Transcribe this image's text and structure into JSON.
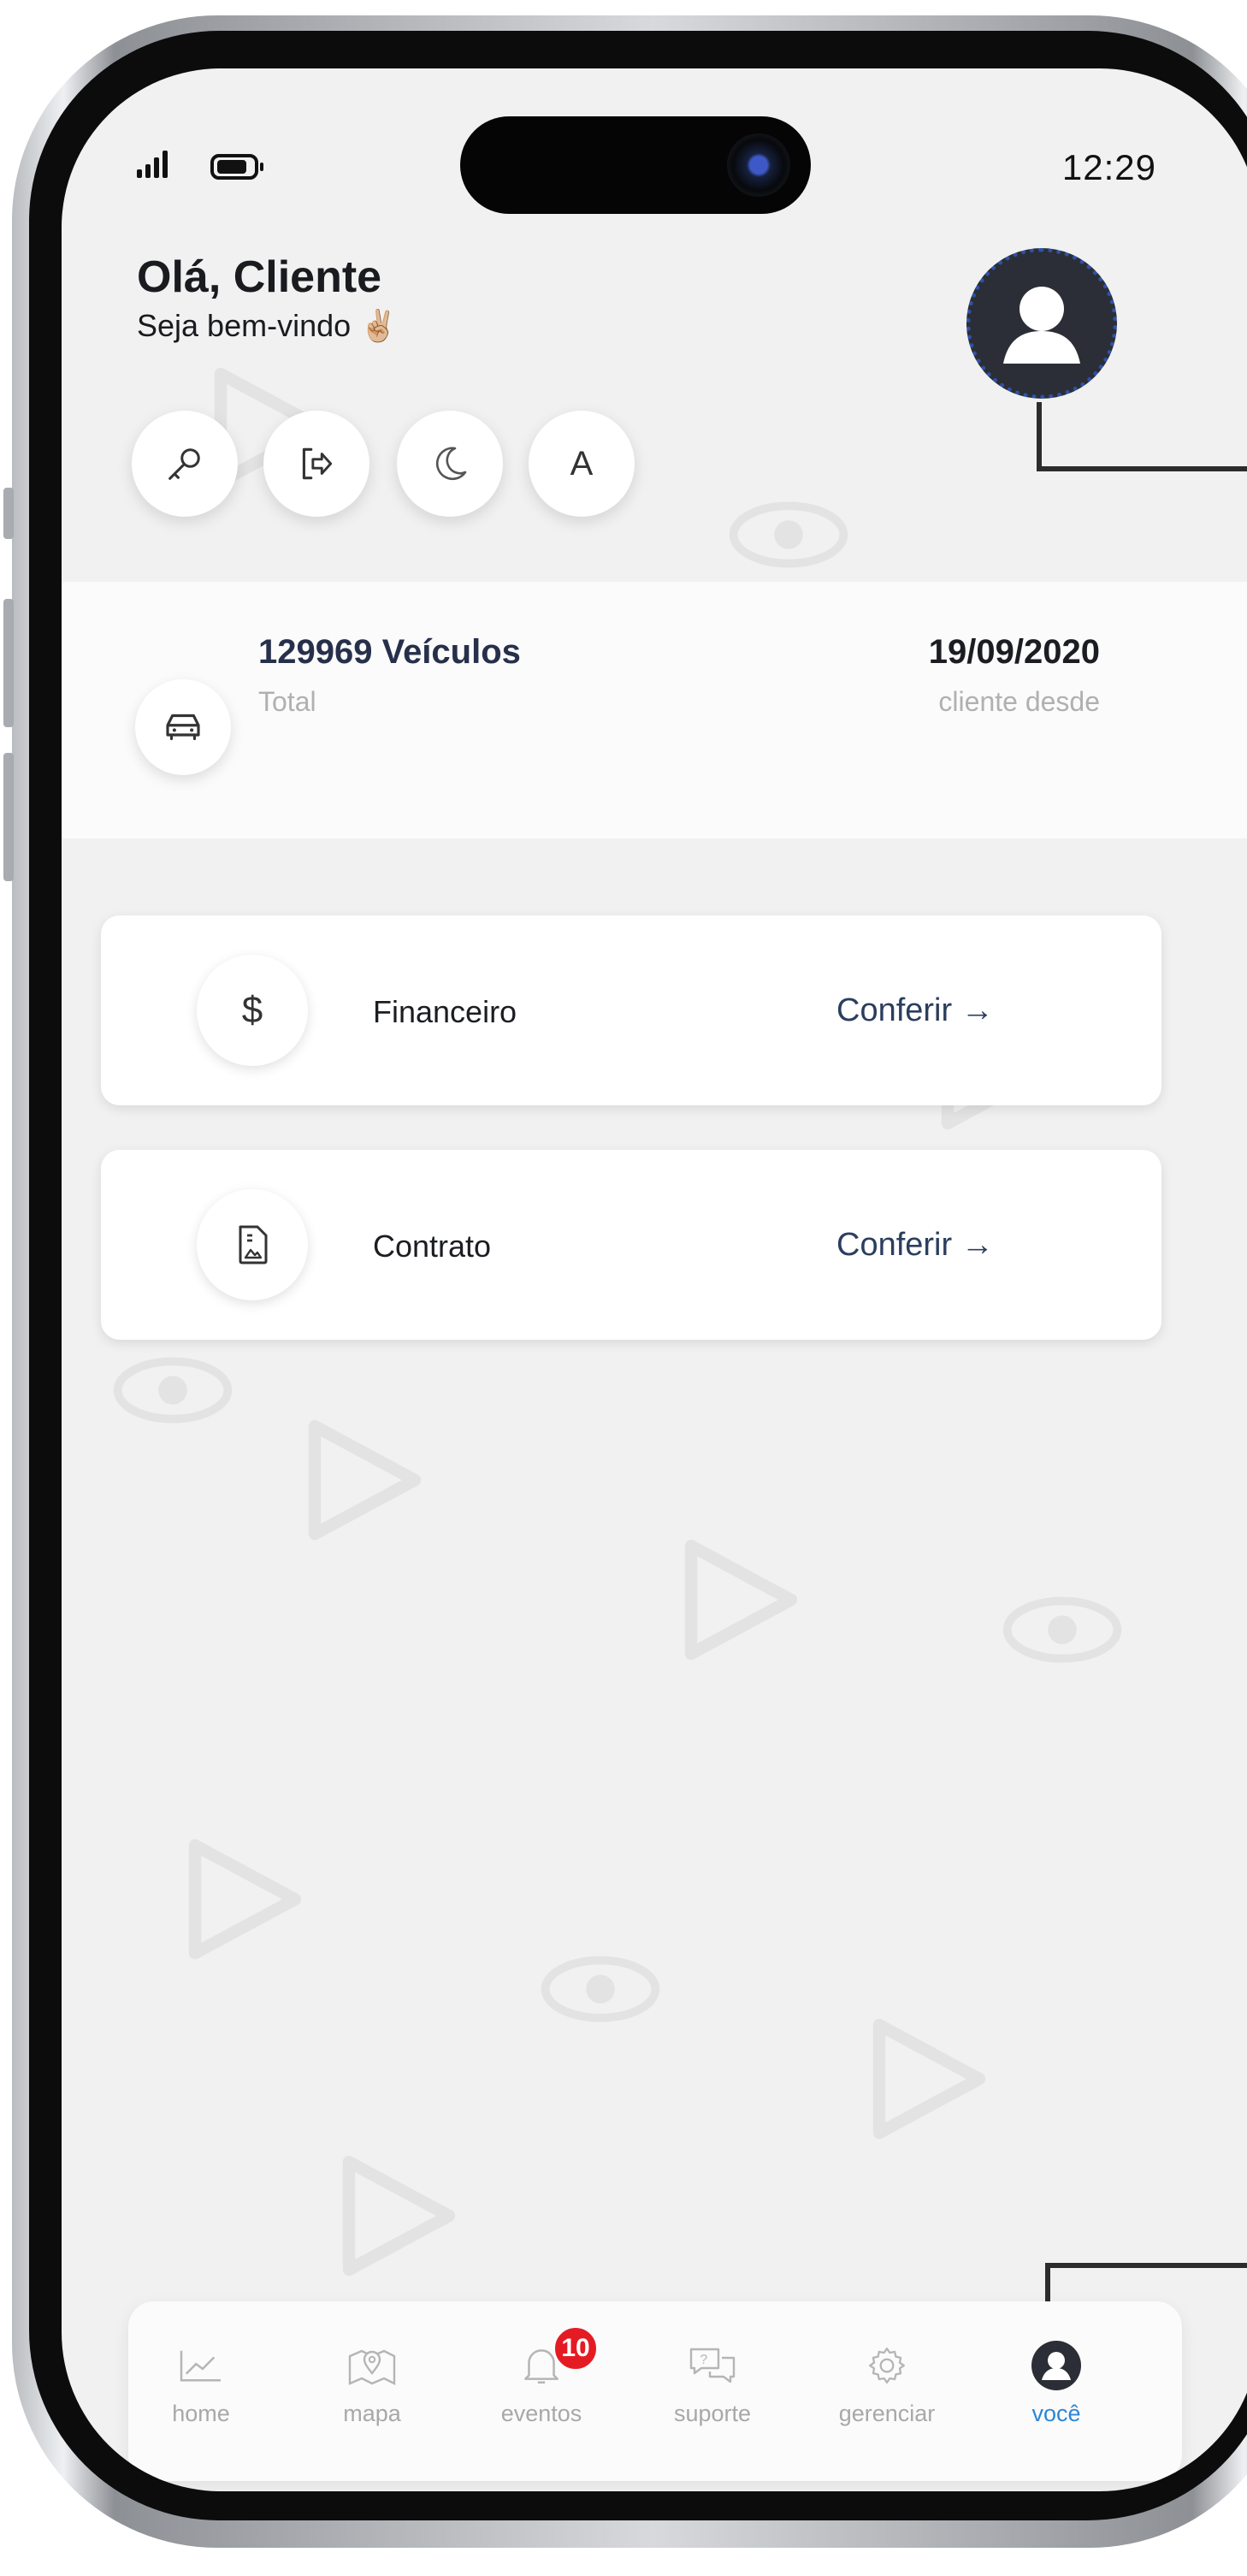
{
  "status_bar": {
    "time": "12:29"
  },
  "header": {
    "greeting": "Olá, Cliente",
    "subtitle": "Seja bem-vindo ✌🏼"
  },
  "quick_actions": [
    {
      "icon": "key-icon"
    },
    {
      "icon": "logout-icon"
    },
    {
      "icon": "moon-icon"
    },
    {
      "icon": "font-size-icon",
      "label": "A"
    }
  ],
  "stats": {
    "vehicles_value": "129969 Veículos",
    "vehicles_label": "Total",
    "since_value": "19/09/2020",
    "since_label": "cliente desde"
  },
  "menu": [
    {
      "icon": "dollar-icon",
      "label": "Financeiro",
      "link": "Conferir →"
    },
    {
      "icon": "document-icon",
      "label": "Contrato",
      "link": "Conferir →"
    }
  ],
  "tabs": [
    {
      "icon": "chart-line-icon",
      "label": "home"
    },
    {
      "icon": "map-pin-icon",
      "label": "mapa"
    },
    {
      "icon": "bell-icon",
      "label": "eventos",
      "badge": "10"
    },
    {
      "icon": "chat-icon",
      "label": "suporte"
    },
    {
      "icon": "gear-icon",
      "label": "gerenciar"
    },
    {
      "icon": "user-icon",
      "label": "você",
      "active": true
    }
  ],
  "colors": {
    "accent": "#2c86d6",
    "badge": "#e51b23",
    "link": "#2b3e5e",
    "background": "#f1f1f2"
  }
}
